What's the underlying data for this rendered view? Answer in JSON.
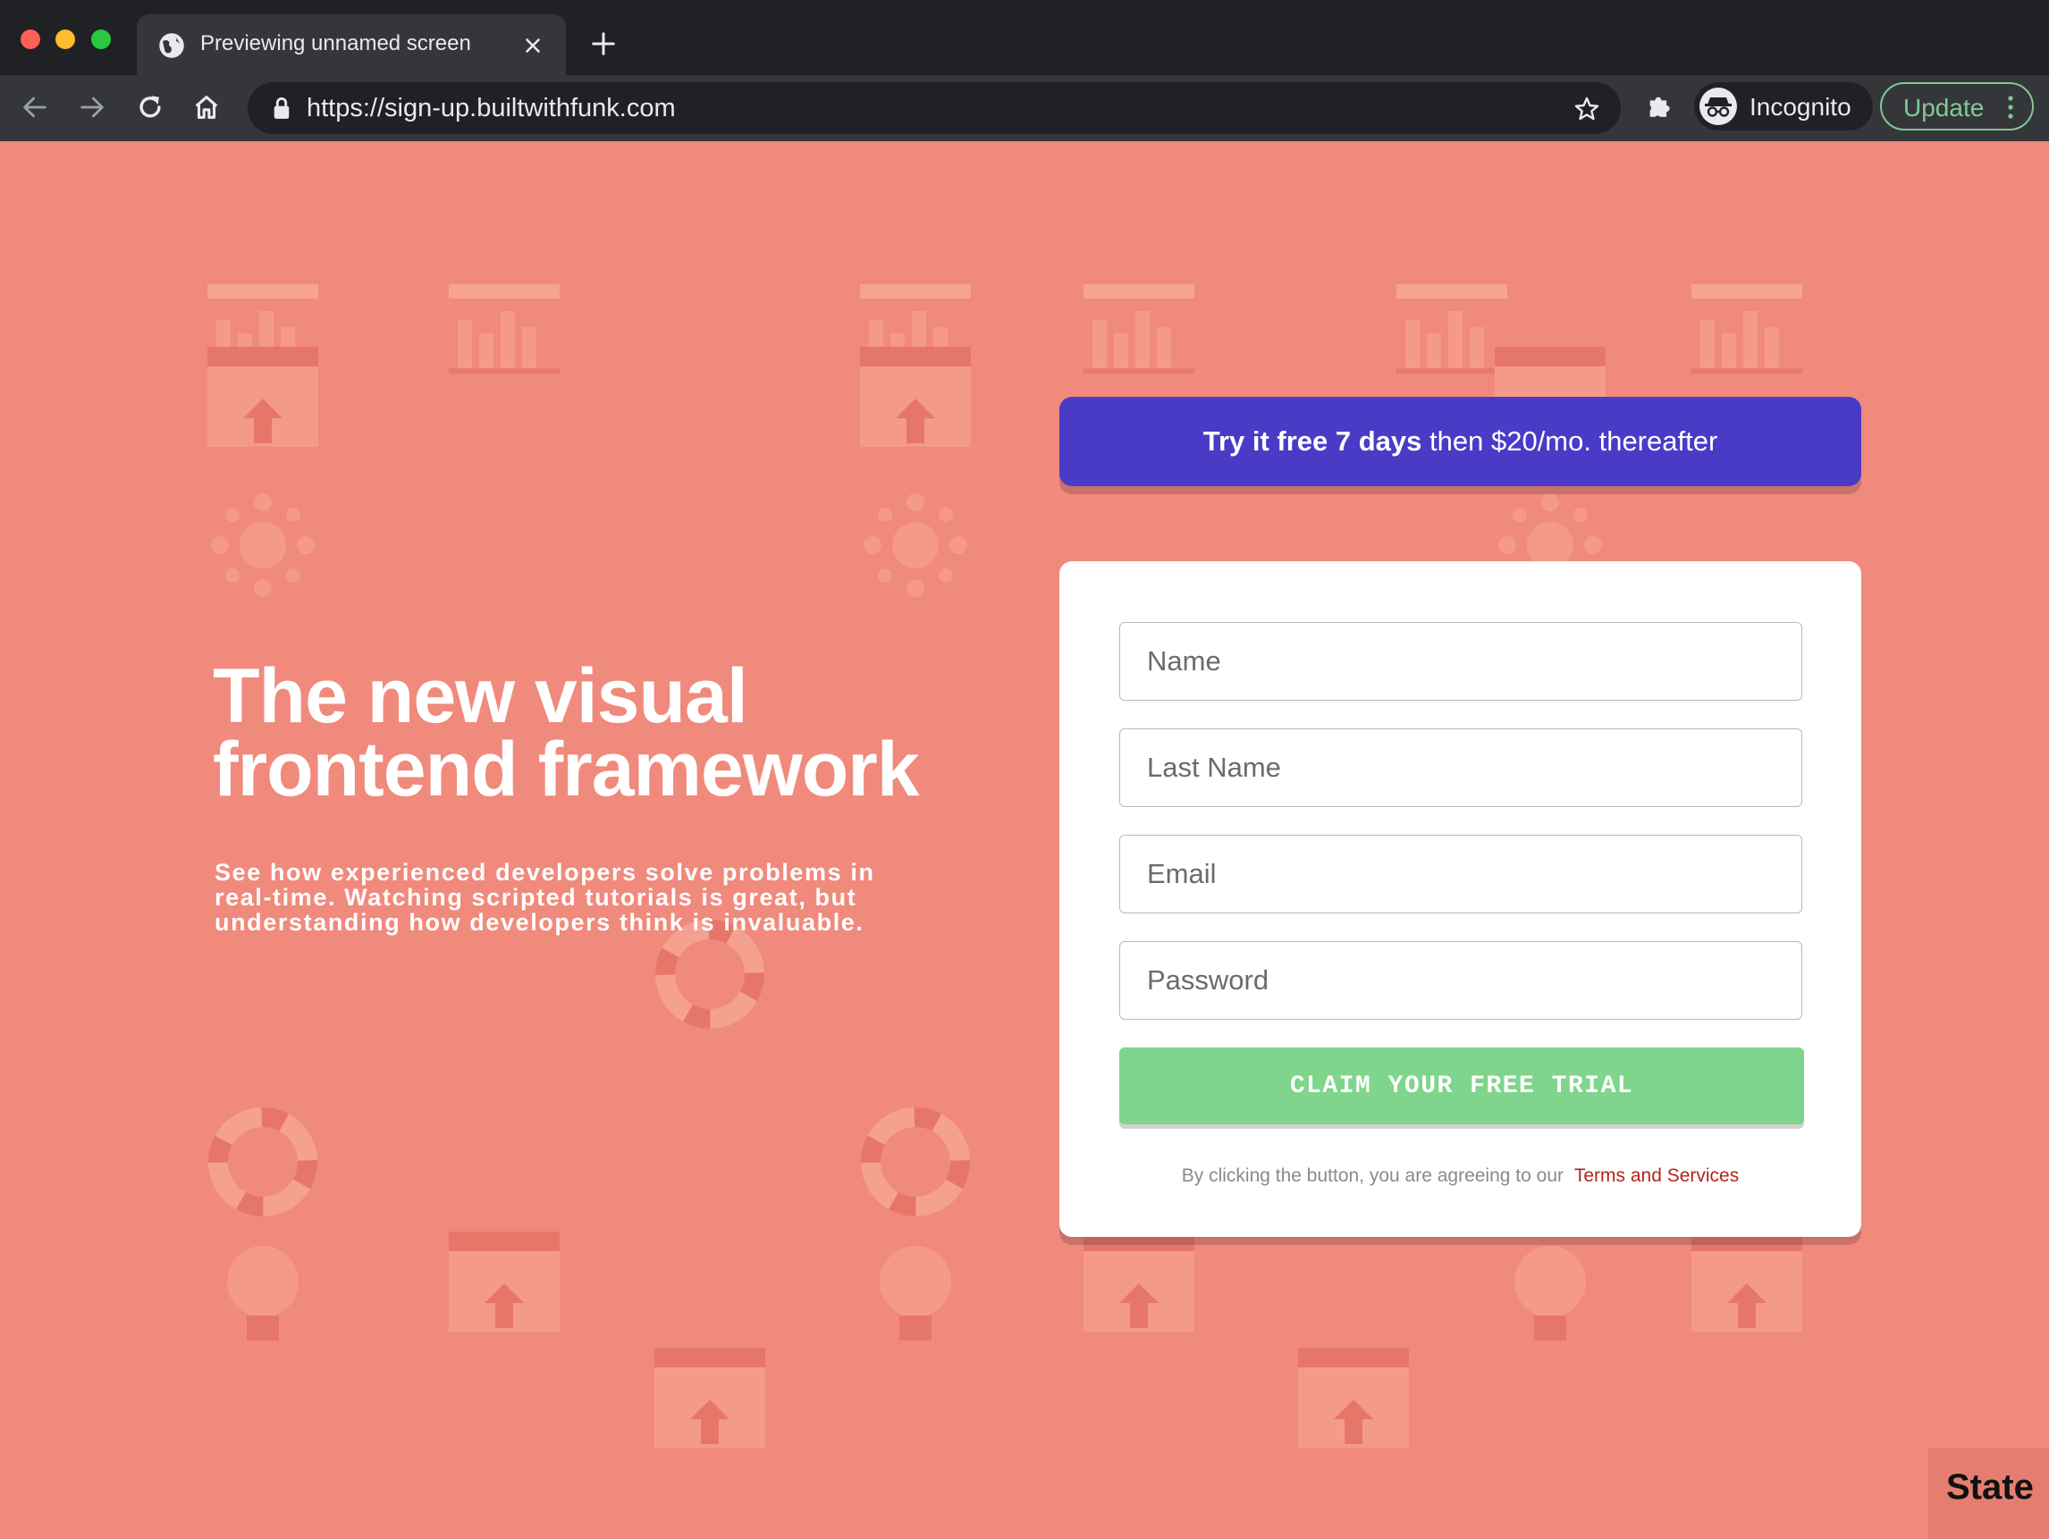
{
  "browser": {
    "tab_title": "Previewing unnamed screen",
    "url": "https://sign-up.builtwithfunk.com",
    "profile_label": "Incognito",
    "update_label": "Update"
  },
  "hero": {
    "title_line1": "The new visual",
    "title_line2": "frontend framework",
    "subtitle": "See how experienced developers solve problems in real-time. Watching scripted tutorials is great, but understanding how developers think is invaluable."
  },
  "promo": {
    "bold_text": "Try it free 7 days",
    "rest_text": " then $20/mo. thereafter"
  },
  "form": {
    "name_placeholder": "Name",
    "last_name_placeholder": "Last Name",
    "email_placeholder": "Email",
    "password_placeholder": "Password",
    "submit_label": "CLAIM YOUR FREE TRIAL",
    "legal_text": "By clicking the button, you are agreeing to our",
    "legal_link": "Terms and Services"
  },
  "devtools": {
    "state_label": "State"
  },
  "colors": {
    "page_background": "#f08a7c",
    "promo_background": "#4a3bc6",
    "cta_background": "#7fd58b",
    "link_color": "#b4231c"
  }
}
